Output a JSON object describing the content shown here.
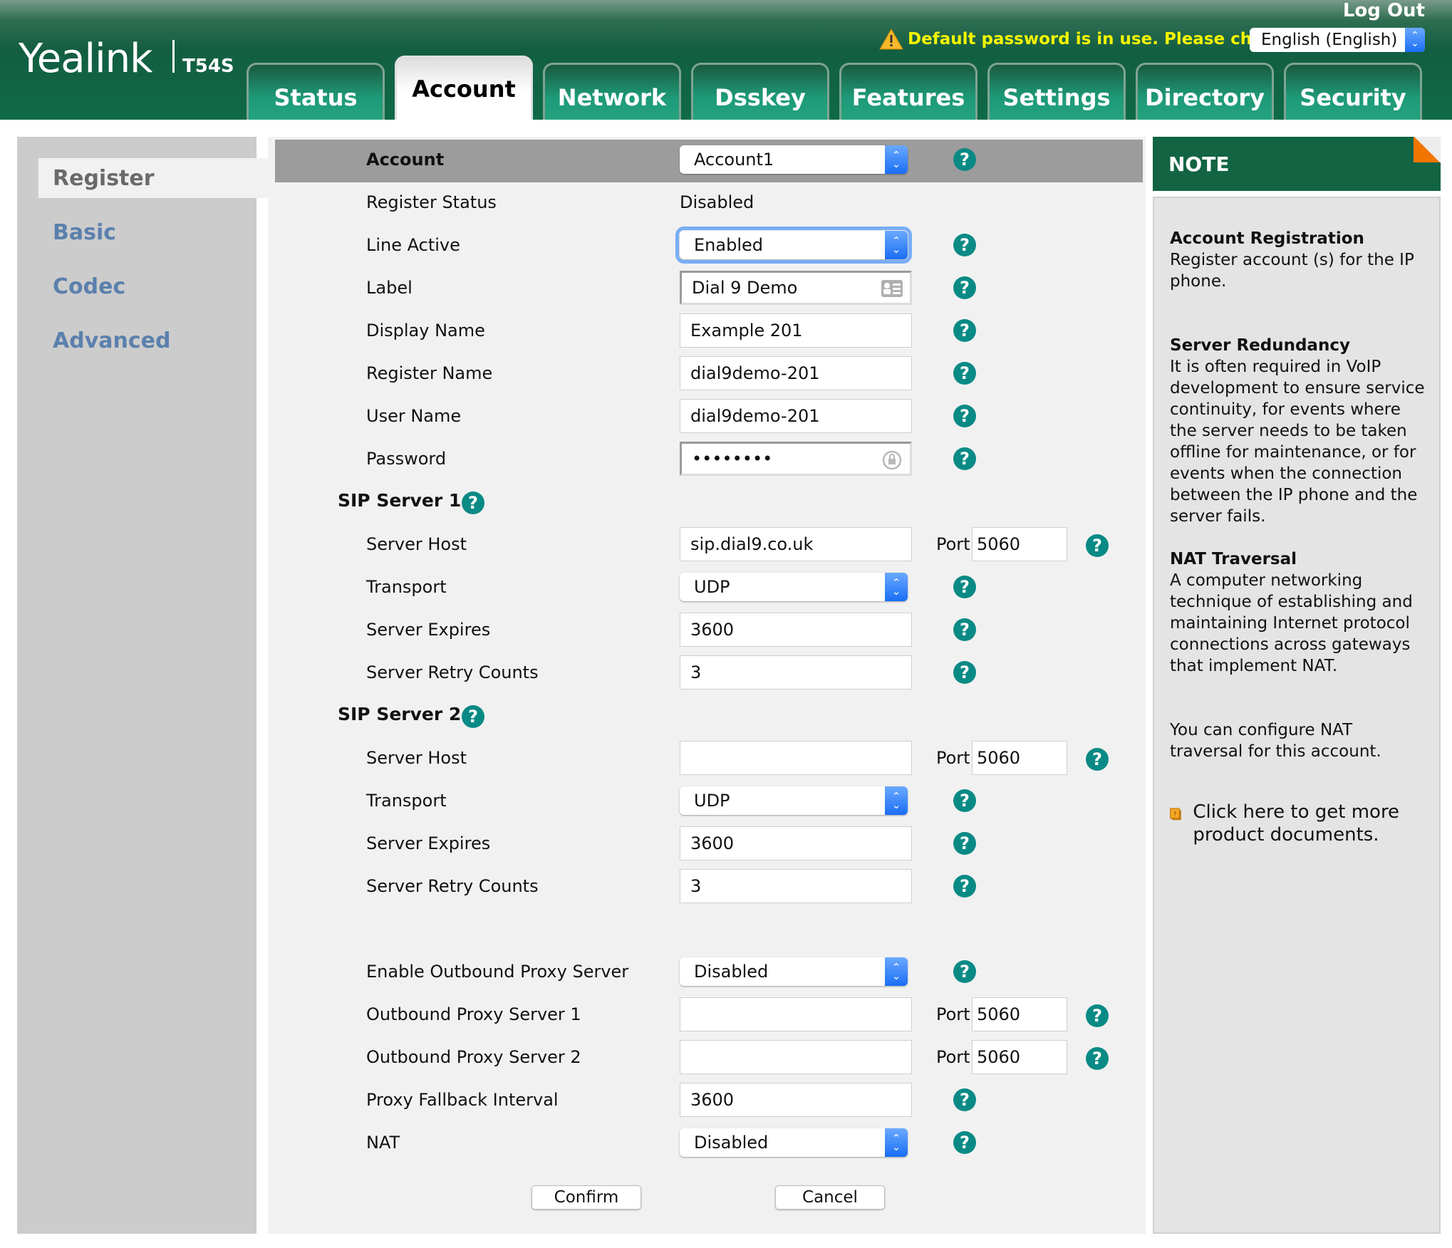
{
  "header": {
    "brand": "Yealink",
    "model": "T54S",
    "logout_label": "Log Out",
    "warning": "Default password is in use. Please change!",
    "language_selected": "English (English)",
    "tabs": [
      {
        "label": "Status",
        "active": false
      },
      {
        "label": "Account",
        "active": true
      },
      {
        "label": "Network",
        "active": false
      },
      {
        "label": "Dsskey",
        "active": false
      },
      {
        "label": "Features",
        "active": false
      },
      {
        "label": "Settings",
        "active": false
      },
      {
        "label": "Directory",
        "active": false
      },
      {
        "label": "Security",
        "active": false
      }
    ]
  },
  "sidebar": {
    "items": [
      {
        "label": "Register",
        "active": true
      },
      {
        "label": "Basic",
        "active": false
      },
      {
        "label": "Codec",
        "active": false
      },
      {
        "label": "Advanced",
        "active": false
      }
    ]
  },
  "form": {
    "account": {
      "label": "Account",
      "value": "Account1"
    },
    "register_status": {
      "label": "Register Status",
      "value": "Disabled"
    },
    "line_active": {
      "label": "Line Active",
      "value": "Enabled"
    },
    "label": {
      "label": "Label",
      "value": "Dial 9 Demo"
    },
    "display_name": {
      "label": "Display Name",
      "value": "Example 201"
    },
    "register_name": {
      "label": "Register Name",
      "value": "dial9demo-201"
    },
    "user_name": {
      "label": "User Name",
      "value": "dial9demo-201"
    },
    "password": {
      "label": "Password",
      "value": "••••••••"
    },
    "sip1": {
      "title": "SIP Server 1",
      "server_host": {
        "label": "Server Host",
        "value": "sip.dial9.co.uk",
        "port_label": "Port",
        "port": "5060"
      },
      "transport": {
        "label": "Transport",
        "value": "UDP"
      },
      "server_expires": {
        "label": "Server Expires",
        "value": "3600"
      },
      "retry_counts": {
        "label": "Server Retry Counts",
        "value": "3"
      }
    },
    "sip2": {
      "title": "SIP Server 2",
      "server_host": {
        "label": "Server Host",
        "value": "",
        "port_label": "Port",
        "port": "5060"
      },
      "transport": {
        "label": "Transport",
        "value": "UDP"
      },
      "server_expires": {
        "label": "Server Expires",
        "value": "3600"
      },
      "retry_counts": {
        "label": "Server Retry Counts",
        "value": "3"
      }
    },
    "outbound_proxy_enable": {
      "label": "Enable Outbound Proxy Server",
      "value": "Disabled"
    },
    "outbound_proxy_1": {
      "label": "Outbound Proxy Server 1",
      "value": "",
      "port_label": "Port",
      "port": "5060"
    },
    "outbound_proxy_2": {
      "label": "Outbound Proxy Server 2",
      "value": "",
      "port_label": "Port",
      "port": "5060"
    },
    "proxy_fallback": {
      "label": "Proxy Fallback Interval",
      "value": "3600"
    },
    "nat": {
      "label": "NAT",
      "value": "Disabled"
    },
    "confirm_label": "Confirm",
    "cancel_label": "Cancel",
    "help_glyph": "?"
  },
  "note": {
    "title": "NOTE",
    "sections": [
      {
        "heading": "Account Registration",
        "text": "Register account (s) for the IP phone."
      },
      {
        "heading": "Server Redundancy",
        "text": "It is often required in VoIP development to ensure service continuity, for events where the server needs to be taken offline for maintenance, or for events when the connection between the IP phone and the server fails."
      },
      {
        "heading": "NAT Traversal",
        "text": "A computer networking technique of establishing and maintaining Internet protocol connections across gateways that implement NAT."
      }
    ],
    "extra": "You can configure NAT traversal for this account.",
    "doc_link": "Click here to get more product documents."
  },
  "colors": {
    "brand_green": "#126443",
    "help_teal": "#0a8a85",
    "warning_yellow": "#f5f500",
    "sidebar_link": "#5b80ad",
    "corner_orange": "#f27500"
  }
}
